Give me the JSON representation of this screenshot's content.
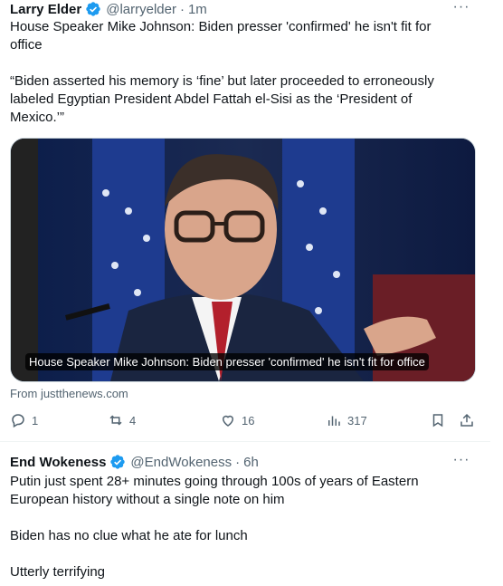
{
  "tweet1": {
    "name": "Larry Elder",
    "handle": "@larryelder",
    "sep": "·",
    "time": "1m",
    "text": "House Speaker Mike Johnson: Biden presser 'confirmed' he isn't fit for office\n\n“Biden asserted his memory is ‘fine’ but later proceeded to erroneously labeled Egyptian President Abdel Fattah el-Sisi as the ‘President of Mexico.’”",
    "card_caption": "House Speaker Mike Johnson: Biden presser 'confirmed' he isn't fit for office",
    "card_source": "From justthenews.com",
    "replies": "1",
    "reposts": "4",
    "likes": "16",
    "views": "317",
    "more": "···"
  },
  "tweet2": {
    "name": "End Wokeness",
    "handle": "@EndWokeness",
    "sep": "·",
    "time": "6h",
    "text": "Putin just spent 28+ minutes going through 100s of years of Eastern European history without a single note on him\n\nBiden has no clue what he ate for lunch\n\nUtterly terrifying",
    "more": "···"
  },
  "icons": {
    "verified": "verified-badge-icon",
    "reply": "reply-icon",
    "repost": "repost-icon",
    "like": "heart-icon",
    "views": "views-chart-icon",
    "bookmark": "bookmark-icon",
    "share": "share-icon",
    "more": "more-icon"
  },
  "colors": {
    "verified": "#1d9bf0",
    "text": "#0f1419",
    "muted": "#536471"
  }
}
